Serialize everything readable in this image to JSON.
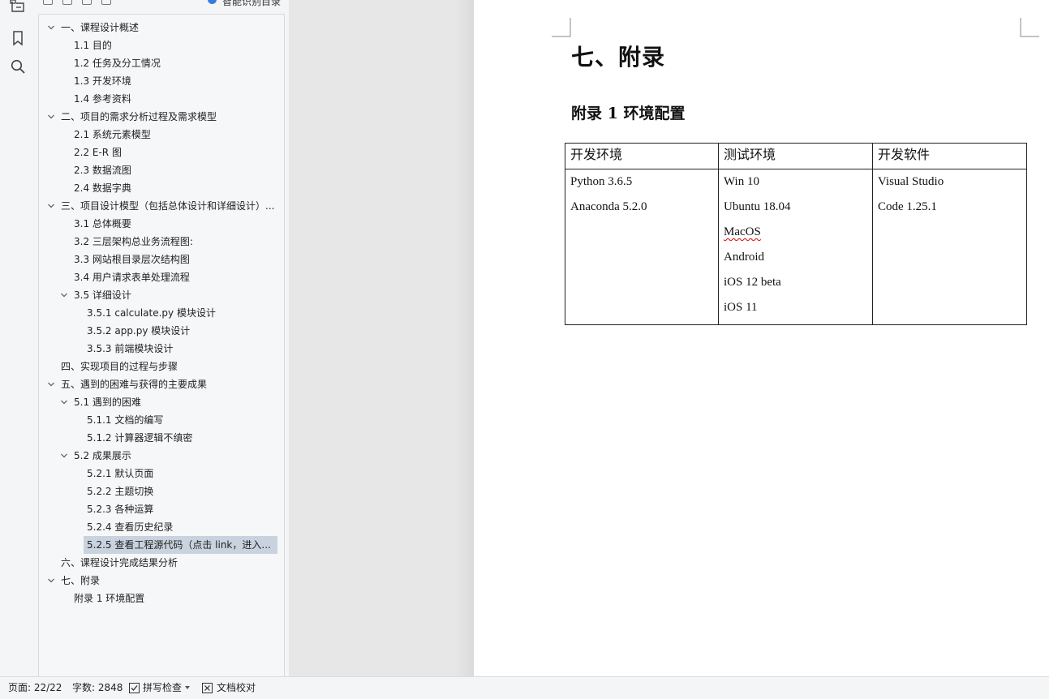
{
  "nav": {
    "smart_label": "智能识别目录",
    "toc": [
      {
        "label": "一、课程设计概述",
        "level": 0,
        "expandable": true
      },
      {
        "label": "1.1 目的",
        "level": 1,
        "expandable": false
      },
      {
        "label": "1.2  任务及分工情况",
        "level": 1,
        "expandable": false
      },
      {
        "label": "1.3 开发环境",
        "level": 1,
        "expandable": false
      },
      {
        "label": "1.4  参考资料",
        "level": 1,
        "expandable": false
      },
      {
        "label": "二、项目的需求分析过程及需求模型",
        "level": 0,
        "expandable": true
      },
      {
        "label": "2.1 系统元素模型",
        "level": 1,
        "expandable": false
      },
      {
        "label": "2.2 E-R 图",
        "level": 1,
        "expandable": false
      },
      {
        "label": "2.3 数据流图",
        "level": 1,
        "expandable": false
      },
      {
        "label": "2.4 数据字典",
        "level": 1,
        "expandable": false
      },
      {
        "label": "三、项目设计模型（包括总体设计和详细设计）...",
        "level": 0,
        "expandable": true
      },
      {
        "label": "3.1 总体概要",
        "level": 1,
        "expandable": false
      },
      {
        "label": "3.2  三层架构总业务流程图:",
        "level": 1,
        "expandable": false
      },
      {
        "label": "3.3  网站根目录层次结构图",
        "level": 1,
        "expandable": false
      },
      {
        "label": "3.4  用户请求表单处理流程",
        "level": 1,
        "expandable": false
      },
      {
        "label": "3.5  详细设计",
        "level": 1,
        "expandable": true
      },
      {
        "label": "3.5.1 calculate.py 模块设计",
        "level": 2,
        "expandable": false
      },
      {
        "label": "3.5.2 app.py 模块设计",
        "level": 2,
        "expandable": false
      },
      {
        "label": "3.5.3 前端模块设计",
        "level": 2,
        "expandable": false
      },
      {
        "label": "四、实现项目的过程与步骤",
        "level": 0,
        "expandable": false
      },
      {
        "label": "五、遇到的困难与获得的主要成果",
        "level": 0,
        "expandable": true
      },
      {
        "label": "5.1 遇到的困难",
        "level": 1,
        "expandable": true
      },
      {
        "label": "5.1.1  文档的编写",
        "level": 2,
        "expandable": false
      },
      {
        "label": "5.1.2  计算器逻辑不缜密",
        "level": 2,
        "expandable": false
      },
      {
        "label": "5.2  成果展示",
        "level": 1,
        "expandable": true
      },
      {
        "label": "5.2.1 默认页面",
        "level": 2,
        "expandable": false
      },
      {
        "label": "5.2.2 主题切换",
        "level": 2,
        "expandable": false
      },
      {
        "label": "5.2.3  各种运算",
        "level": 2,
        "expandable": false
      },
      {
        "label": "5.2.4 查看历史纪录",
        "level": 2,
        "expandable": false
      },
      {
        "label": "5.2.5 查看工程源代码（点击 link，进入...",
        "level": 2,
        "expandable": false,
        "selected": true
      },
      {
        "label": "六、课程设计完成结果分析",
        "level": 0,
        "expandable": false
      },
      {
        "label": "七、附录",
        "level": 0,
        "expandable": true
      },
      {
        "label": "附录 1 环境配置",
        "level": 1,
        "expandable": false
      }
    ]
  },
  "document": {
    "heading": "七、附录",
    "subheading": "附录 1 环境配置",
    "table": {
      "headers": [
        "开发环境",
        "测试环境",
        "开发软件"
      ],
      "columns": [
        [
          {
            "text": "Python 3.6.5"
          },
          {
            "text": "Anaconda 5.2.0"
          }
        ],
        [
          {
            "text": "Win 10"
          },
          {
            "text": "Ubuntu 18.04"
          },
          {
            "text": "MacOS",
            "spell_error": true
          },
          {
            "text": "Android"
          },
          {
            "text": "iOS 12 beta"
          },
          {
            "text": "iOS 11"
          }
        ],
        [
          {
            "text": "Visual Studio"
          },
          {
            "text": "Code 1.25.1"
          }
        ]
      ]
    }
  },
  "status_bar": {
    "page": "页面: 22/22",
    "words": "字数: 2848",
    "spell_check": "拼写检查",
    "doc_proof": "文档校对"
  },
  "colors": {
    "selection": "#c9d3df",
    "accent": "#3a7be0",
    "spell_error": "#d00000"
  }
}
